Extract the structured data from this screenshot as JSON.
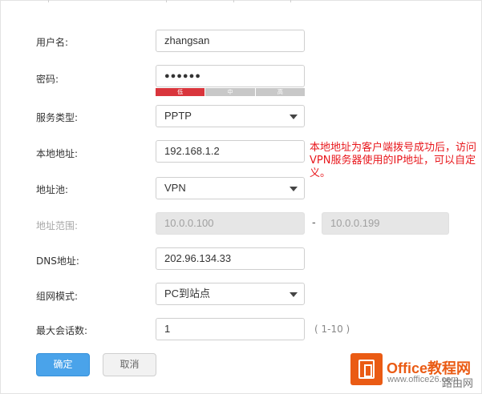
{
  "form": {
    "username_label": "用户名:",
    "username_value": "zhangsan",
    "password_label": "密码:",
    "password_value": "●●●●●●",
    "strength": {
      "low": "低",
      "mid": "中",
      "high": "高",
      "level": 0.33
    },
    "service_type_label": "服务类型:",
    "service_type_value": "PPTP",
    "local_address_label": "本地地址:",
    "local_address_value": "192.168.1.2",
    "pool_label": "地址池:",
    "pool_value": "VPN",
    "range_label": "地址范围:",
    "range_start": "10.0.0.100",
    "range_sep": "-",
    "range_end": "10.0.0.199",
    "dns_label": "DNS地址:",
    "dns_value": "202.96.134.33",
    "network_mode_label": "组网模式:",
    "network_mode_value": "PC到站点",
    "max_sessions_label": "最大会话数:",
    "max_sessions_value": "1",
    "max_sessions_hint": "( 1-10 )"
  },
  "buttons": {
    "confirm": "确定",
    "cancel": "取消"
  },
  "annotation": "本地地址为客户端拨号成功后，访问VPN服务器使用的IP地址，可以自定义。",
  "branding": {
    "name": "Office教程网",
    "url": "www.office26.com",
    "watermark": "路由网"
  },
  "colors": {
    "primary": "#4aa3ea",
    "note": "#e8161b",
    "strength_low": "#d9353c",
    "brand": "#ea5b14"
  }
}
